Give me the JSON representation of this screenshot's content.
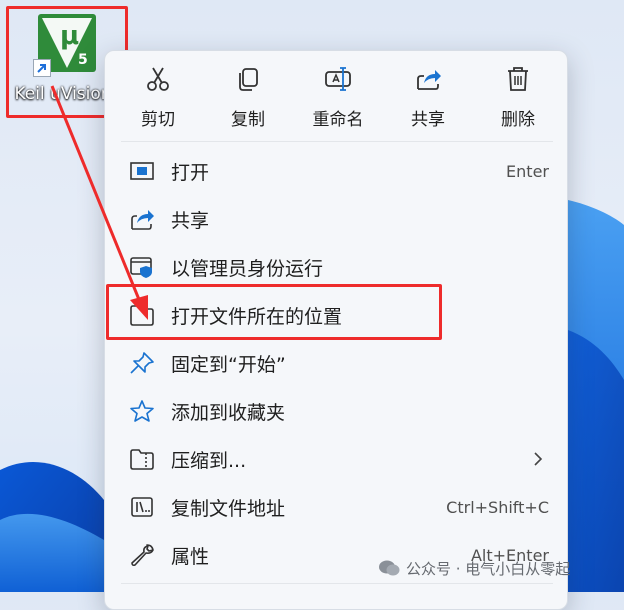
{
  "desktop": {
    "icon_label": "Keil uVision",
    "icon_glyph": "μ",
    "icon_version": "5",
    "icon_color": "#2f8b3a"
  },
  "menu": {
    "top_actions": [
      {
        "label": "剪切",
        "icon": "scissors-icon"
      },
      {
        "label": "复制",
        "icon": "copy-icon"
      },
      {
        "label": "重命名",
        "icon": "rename-icon"
      },
      {
        "label": "共享",
        "icon": "share-icon"
      },
      {
        "label": "删除",
        "icon": "trash-icon"
      }
    ],
    "items": [
      {
        "label": "打开",
        "shortcut": "Enter",
        "icon": "open-window-icon"
      },
      {
        "label": "共享",
        "shortcut": "",
        "icon": "share-icon"
      },
      {
        "label": "以管理员身份运行",
        "shortcut": "",
        "icon": "admin-shield-icon"
      },
      {
        "label": "打开文件所在的位置",
        "shortcut": "",
        "icon": "folder-icon"
      },
      {
        "label": "固定到“开始”",
        "shortcut": "",
        "icon": "pin-icon"
      },
      {
        "label": "添加到收藏夹",
        "shortcut": "",
        "icon": "star-icon"
      },
      {
        "label": "压缩到...",
        "shortcut": "",
        "icon": "zip-folder-icon",
        "submenu": true
      },
      {
        "label": "复制文件地址",
        "shortcut": "Ctrl+Shift+C",
        "icon": "copy-path-icon"
      },
      {
        "label": "属性",
        "shortcut": "Alt+Enter",
        "icon": "wrench-icon"
      }
    ]
  },
  "watermark": {
    "text": "公众号 · 电气小白从零起"
  },
  "colors": {
    "highlight": "#ee2b2b",
    "accent": "#1a73d0",
    "windows_blue": "#1e6fd9"
  }
}
